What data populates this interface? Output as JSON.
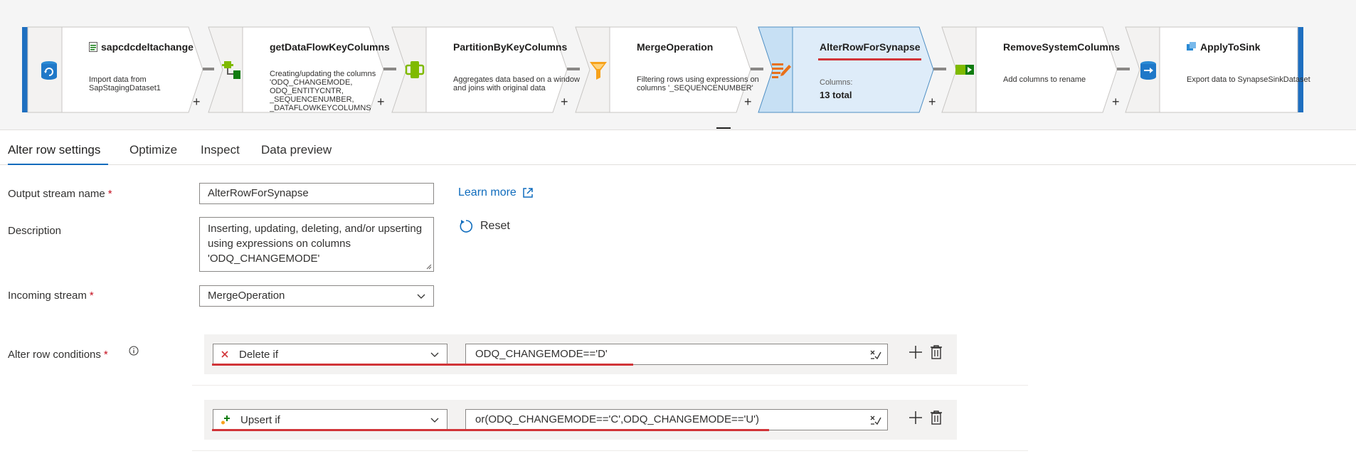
{
  "flow": {
    "nodes": [
      {
        "title": "sapcdcdeltachange",
        "desc": "Import data from SapStagingDataset1"
      },
      {
        "title": "getDataFlowKeyColumns",
        "desc": "Creating/updating the columns 'ODQ_CHANGEMODE, ODQ_ENTITYCNTR, _SEQUENCENUMBER, _DATAFLOWKEYCOLUMNS"
      },
      {
        "title": "PartitionByKeyColumns",
        "desc": "Aggregates data based on a window and joins with original data"
      },
      {
        "title": "MergeOperation",
        "desc": "Filtering rows using expressions on columns '_SEQUENCENUMBER'"
      },
      {
        "title": "AlterRowForSynapse",
        "meta_label": "Columns:",
        "meta_value": "13 total"
      },
      {
        "title": "RemoveSystemColumns",
        "desc": "Add columns to rename"
      },
      {
        "title": "ApplyToSink",
        "desc": "Export data to SynapseSinkDataset"
      }
    ],
    "plus": "+"
  },
  "tabs": [
    "Alter row settings",
    "Optimize",
    "Inspect",
    "Data preview"
  ],
  "form": {
    "output_stream_label": "Output stream name",
    "output_stream_value": "AlterRowForSynapse",
    "description_label": "Description",
    "description_value": "Inserting, updating, deleting, and/or upserting using expressions on columns 'ODQ_CHANGEMODE'",
    "incoming_label": "Incoming stream",
    "incoming_value": "MergeOperation",
    "conditions_label": "Alter row conditions",
    "required_mark": "*",
    "learn_more": "Learn more",
    "reset": "Reset",
    "conditions": [
      {
        "type": "Delete if",
        "expression": "ODQ_CHANGEMODE=='D'"
      },
      {
        "type": "Upsert if",
        "expression": "or(ODQ_CHANGEMODE=='C',ODQ_CHANGEMODE=='U')"
      }
    ]
  },
  "colors": {
    "accent": "#0f6cbd",
    "selected_node": "#deecf9",
    "annotation_red": "#d13438"
  }
}
